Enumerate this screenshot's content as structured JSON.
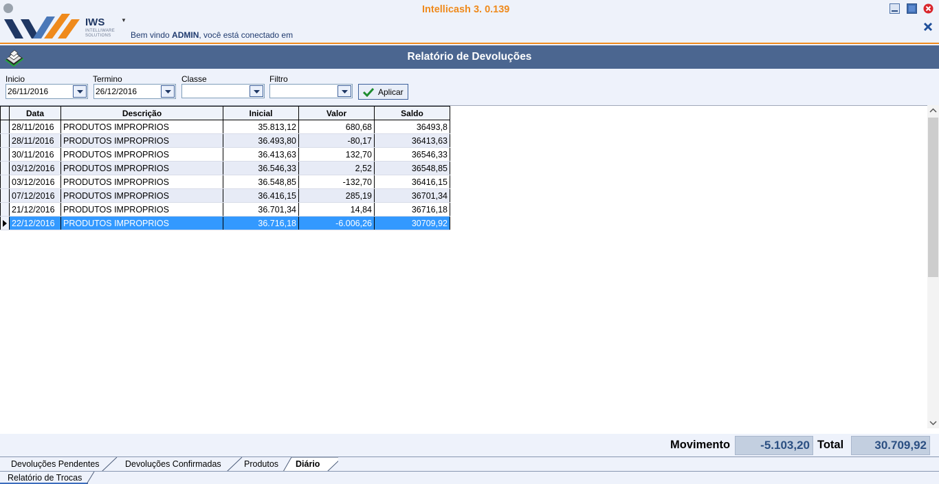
{
  "app": {
    "title": "Intellicash 3. 0.139",
    "logo_name": "IWS",
    "logo_sub1": "INTELLIWARE",
    "logo_sub2": "SOLUTIONS",
    "welcome_prefix": "Bem vindo ",
    "welcome_user": "ADMIN",
    "welcome_suffix": ", você está conectado em"
  },
  "report": {
    "title": "Relatório de Devoluções"
  },
  "filters": {
    "inicio_label": "Inicio",
    "inicio_value": "26/11/2016",
    "termino_label": "Termino",
    "termino_value": "26/12/2016",
    "classe_label": "Classe",
    "classe_value": "",
    "filtro_label": "Filtro",
    "filtro_value": "",
    "apply_label": "Aplicar"
  },
  "grid": {
    "columns": [
      "Data",
      "Descrição",
      "Inicial",
      "Valor",
      "Saldo"
    ],
    "rows": [
      [
        "28/11/2016",
        "PRODUTOS IMPROPRIOS",
        "35.813,12",
        "680,68",
        "36493,8"
      ],
      [
        "28/11/2016",
        "PRODUTOS IMPROPRIOS",
        "36.493,80",
        "-80,17",
        "36413,63"
      ],
      [
        "30/11/2016",
        "PRODUTOS IMPROPRIOS",
        "36.413,63",
        "132,70",
        "36546,33"
      ],
      [
        "03/12/2016",
        "PRODUTOS IMPROPRIOS",
        "36.546,33",
        "2,52",
        "36548,85"
      ],
      [
        "03/12/2016",
        "PRODUTOS IMPROPRIOS",
        "36.548,85",
        "-132,70",
        "36416,15"
      ],
      [
        "07/12/2016",
        "PRODUTOS IMPROPRIOS",
        "36.416,15",
        "285,19",
        "36701,34"
      ],
      [
        "21/12/2016",
        "PRODUTOS IMPROPRIOS",
        "36.701,34",
        "14,84",
        "36716,18"
      ],
      [
        "22/12/2016",
        "PRODUTOS IMPROPRIOS",
        "36.716,18",
        "-6.006,26",
        "30709,92"
      ]
    ],
    "selected_row": 7
  },
  "totals": {
    "movimento_label": "Movimento",
    "movimento_value": "-5.103,20",
    "total_label": "Total",
    "total_value": "30.709,92"
  },
  "tabs": {
    "items": [
      "Devoluções Pendentes",
      "Devoluções Confirmadas",
      "Produtos",
      "Diário"
    ],
    "active": "Diário",
    "bottom_tab": "Relatório de Trocas"
  },
  "colors": {
    "accent_orange": "#ef8a1c",
    "title_bar": "#4b6690",
    "selection": "#3399ff",
    "total_text": "#2b4f82"
  },
  "icons": {
    "logo": "iws-logo",
    "printer": "printer-icon",
    "apply": "checkmark-icon",
    "minimize": "minimize-icon",
    "maximize": "maximize-icon",
    "close": "close-icon",
    "close_x": "close-x-icon",
    "dropdown": "chevron-down-icon"
  }
}
